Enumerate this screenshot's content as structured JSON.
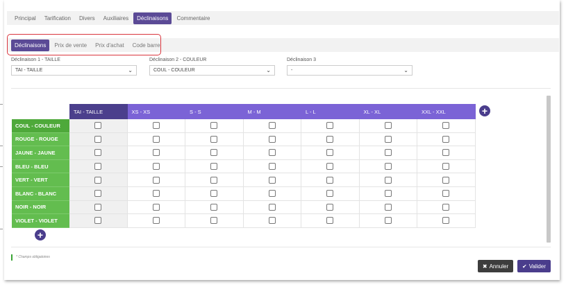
{
  "tabs_main": [
    "Principal",
    "Tarification",
    "Divers",
    "Auxiliaires",
    "Déclinaisons",
    "Commentaire"
  ],
  "tabs_main_active": "Déclinaisons",
  "tabs_sub": [
    "Déclinaisons",
    "Prix de vente",
    "Prix d'achat",
    "Code barre"
  ],
  "tabs_sub_active": "Déclinaisons",
  "selectors": [
    {
      "label": "Déclinaison 1 - TAILLE",
      "value": "TAI - TAILLE"
    },
    {
      "label": "Déclinaison 2 - COULEUR",
      "value": "COUL - COULEUR"
    },
    {
      "label": "Déclinaison 3",
      "value": "-"
    }
  ],
  "grid": {
    "columns": [
      "TAI - TAILLE",
      "XS - XS",
      "S - S",
      "M - M",
      "L - L",
      "XL - XL",
      "XXL - XXL"
    ],
    "rows": [
      "COUL - COULEUR",
      "ROUGE - ROUGE",
      "JAUNE - JAUNE",
      "BLEU - BLEU",
      "VERT - VERT",
      "BLANC - BLANC",
      "NOIR - NOIR",
      "VIOLET - VIOLET"
    ]
  },
  "footer": {
    "required_note": "* Champs obligatoires",
    "cancel_label": "Annuler",
    "validate_label": "Valider"
  },
  "colors": {
    "accent": "#5b4a96",
    "column_header": "#7b63d6",
    "row_header": "#63bd4f",
    "highlight_border": "#d9343c"
  }
}
